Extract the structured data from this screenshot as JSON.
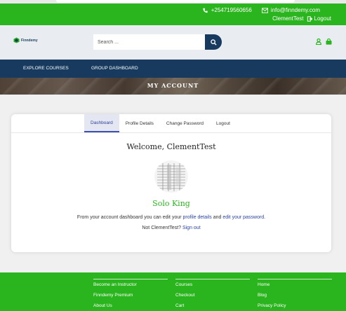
{
  "topbar": {
    "phone": "+254719560656",
    "email": "info@finndemy.com",
    "username": "ClementTest",
    "logout": "Logout"
  },
  "header": {
    "logo_text": "Finndemy",
    "search_placeholder": "Search ..."
  },
  "nav": {
    "items": [
      "EXPLORE COURSES",
      "GROUP DASHBOARD"
    ]
  },
  "banner": {
    "title": "MY ACCOUNT"
  },
  "account": {
    "tabs": [
      "Dashboard",
      "Profile Details",
      "Change Password",
      "Logout"
    ],
    "active_tab": "Dashboard",
    "welcome": "Welcome, ClementTest",
    "display_name": "Solo King",
    "dashboard_text_pre": "From your account dashboard you can edit your ",
    "profile_details_link": "profile details",
    "dashboard_text_mid": " and ",
    "edit_password_link": "edit your password",
    "dashboard_text_post": ".",
    "not_user_text": "Not ClementTest? ",
    "sign_out_link": "Sign out"
  },
  "footer": {
    "columns": [
      [
        "Become an Instructor",
        "Finndemy Premium",
        "About Us"
      ],
      [
        "Courses",
        "Checkout",
        "Cart"
      ],
      [
        "Home",
        "Blog",
        "Privacy Policy"
      ]
    ]
  },
  "colors": {
    "brand_green": "#2ab41d",
    "navy": "#173a5e",
    "link_blue": "#2c44a4"
  },
  "icons": [
    "phone-icon",
    "envelope-icon",
    "logout-icon",
    "search-icon",
    "user-icon",
    "cart-icon",
    "logo-icon"
  ]
}
